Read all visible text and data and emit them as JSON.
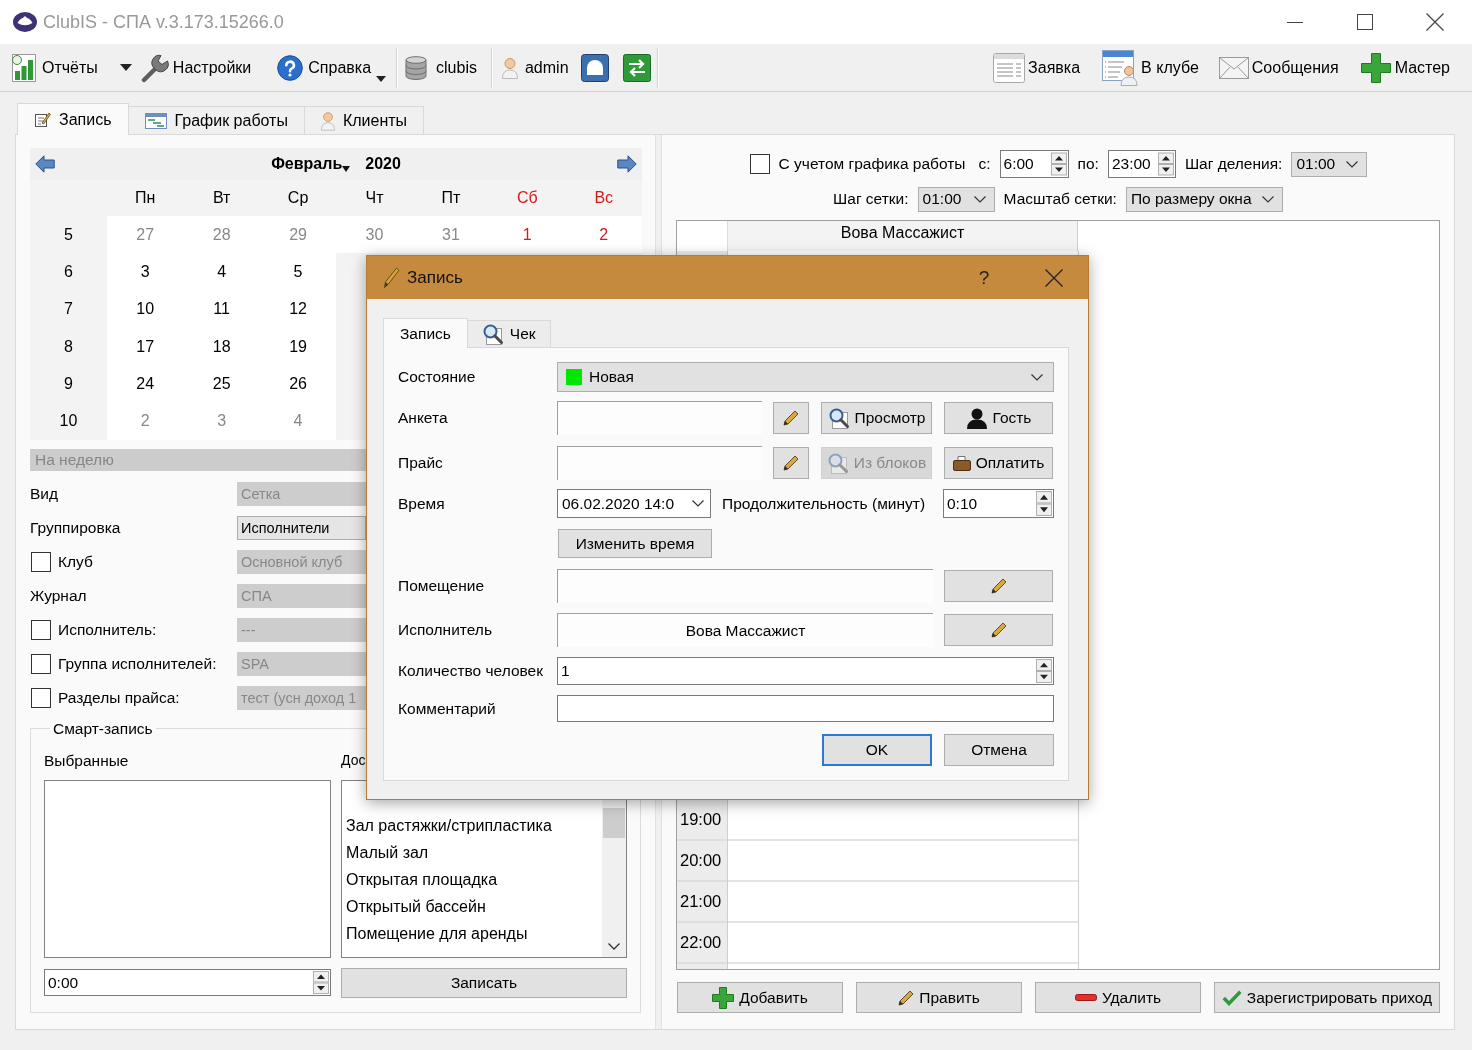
{
  "window": {
    "title": "ClubIS - СПА v.3.173.15266.0"
  },
  "toolbar": {
    "reports": "Отчёты",
    "settings": "Настройки",
    "help": "Справка",
    "database": "clubis",
    "user": "admin",
    "request": "Заявка",
    "in_club": "В клубе",
    "messages": "Сообщения",
    "wizard": "Мастер"
  },
  "main_tabs": [
    {
      "label": "Запись",
      "selected": true
    },
    {
      "label": "График работы",
      "selected": false
    },
    {
      "label": "Клиенты",
      "selected": false
    }
  ],
  "calendar": {
    "month": "Февраль",
    "year": "2020",
    "weekdays": [
      {
        "label": "Пн",
        "weekend": false
      },
      {
        "label": "Вт",
        "weekend": false
      },
      {
        "label": "Ср",
        "weekend": false
      },
      {
        "label": "Чт",
        "weekend": false
      },
      {
        "label": "Пт",
        "weekend": false
      },
      {
        "label": "Сб",
        "weekend": true
      },
      {
        "label": "Вс",
        "weekend": true
      }
    ],
    "weeks": [
      {
        "number": "5",
        "days": [
          {
            "day": "27",
            "other_month": true
          },
          {
            "day": "28",
            "other_month": true
          },
          {
            "day": "29",
            "other_month": true
          },
          {
            "day": "30",
            "other_month": true
          },
          {
            "day": "31",
            "other_month": true
          },
          {
            "day": "1",
            "other_month": false
          },
          {
            "day": "2",
            "other_month": false
          }
        ]
      },
      {
        "number": "6",
        "days": [
          {
            "day": "3",
            "other_month": false
          },
          {
            "day": "4",
            "other_month": false
          },
          {
            "day": "5",
            "other_month": false
          }
        ]
      },
      {
        "number": "7",
        "days": [
          {
            "day": "10",
            "other_month": false
          },
          {
            "day": "11",
            "other_month": false
          },
          {
            "day": "12",
            "other_month": false
          }
        ]
      },
      {
        "number": "8",
        "days": [
          {
            "day": "17",
            "other_month": false
          },
          {
            "day": "18",
            "other_month": false
          },
          {
            "day": "19",
            "other_month": false
          }
        ]
      },
      {
        "number": "9",
        "days": [
          {
            "day": "24",
            "other_month": false
          },
          {
            "day": "25",
            "other_month": false
          },
          {
            "day": "26",
            "other_month": false
          }
        ]
      },
      {
        "number": "10",
        "days": [
          {
            "day": "2",
            "other_month": true
          },
          {
            "day": "3",
            "other_month": true
          },
          {
            "day": "4",
            "other_month": true
          }
        ]
      }
    ]
  },
  "filters": {
    "week_button": {
      "label": "На неделю",
      "disabled": true
    },
    "rows": [
      {
        "kind": "label",
        "label": "Вид",
        "value": "Сетка",
        "disabled": true
      },
      {
        "kind": "label",
        "label": "Группировка",
        "value": "Исполнители",
        "disabled": false
      },
      {
        "kind": "checkbox",
        "label": "Клуб",
        "checked": false,
        "value": "Основной клуб",
        "disabled": true
      },
      {
        "kind": "label",
        "label": "Журнал",
        "value": "СПА",
        "disabled": true
      },
      {
        "kind": "checkbox",
        "label": "Исполнитель:",
        "checked": false,
        "value": "---",
        "disabled": true
      },
      {
        "kind": "checkbox",
        "label": "Группа исполнителей:",
        "checked": false,
        "value": "SPA",
        "disabled": true
      },
      {
        "kind": "checkbox",
        "label": "Разделы прайса:",
        "checked": false,
        "value": "тест (усн доход 1",
        "disabled": true
      }
    ]
  },
  "smart_booking": {
    "title": "Смарт-запись",
    "selected_label": "Выбранные",
    "available_label": "Дос",
    "available_items": [
      "Зал растяжки/стрипластика",
      "Малый зал",
      "Открытая площадка",
      "Открытый бассейн",
      "Помещение для аренды"
    ],
    "duration": "0:00",
    "submit": "Записать"
  },
  "schedule": {
    "use_work_schedule": {
      "label": "С учетом графика работы",
      "checked": false
    },
    "from_label": "с:",
    "from": "6:00",
    "to_label": "по:",
    "to": "23:00",
    "division_label": "Шаг деления:",
    "division": "01:00",
    "grid_step_label": "Шаг сетки:",
    "grid_step": "01:00",
    "scale_label": "Масштаб сетки:",
    "scale": "По размеру окна",
    "resource": "Вова Массажист",
    "times": [
      "19:00",
      "20:00",
      "21:00",
      "22:00"
    ],
    "actions": [
      "Добавить",
      "Править",
      "Удалить",
      "Зарегистрировать приход"
    ]
  },
  "dialog": {
    "title": "Запись",
    "help": "?",
    "tabs": [
      {
        "label": "Запись",
        "selected": true
      },
      {
        "label": "Чек",
        "selected": false
      }
    ],
    "state": {
      "label": "Состояние",
      "value": "Новая",
      "color": "#00e600"
    },
    "profile": {
      "label": "Анкета"
    },
    "view_button": "Просмотр",
    "guest_button": "Гость",
    "price": {
      "label": "Прайс"
    },
    "from_blocks_button": {
      "label": "Из блоков",
      "disabled": true
    },
    "pay_button": "Оплатить",
    "time": {
      "label": "Время",
      "value": "06.02.2020 14:0"
    },
    "duration": {
      "label": "Продолжительность (минут)",
      "value": "0:10"
    },
    "change_time_button": "Изменить время",
    "room": {
      "label": "Помещение"
    },
    "performer": {
      "label": "Исполнитель",
      "value": "Вова Массажист"
    },
    "people": {
      "label": "Количество человек",
      "value": "1"
    },
    "comment": {
      "label": "Комментарий"
    },
    "buttons": [
      {
        "label": "OK",
        "default": true
      },
      {
        "label": "Отмена",
        "default": false
      }
    ]
  }
}
